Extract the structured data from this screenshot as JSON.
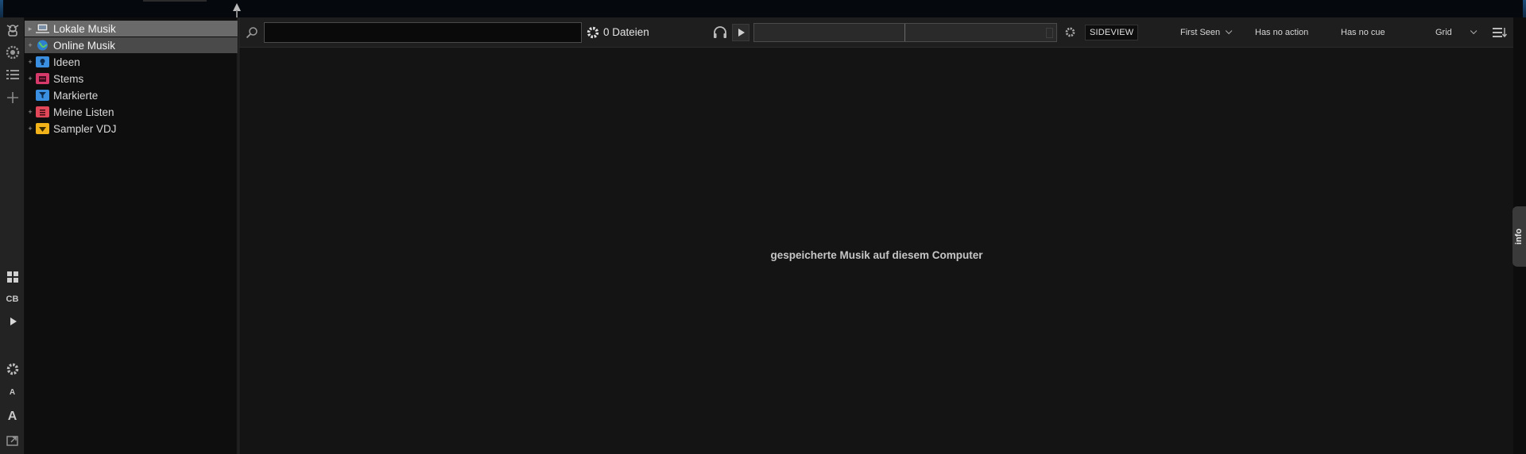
{
  "tree": {
    "items": [
      {
        "label": "Lokale Musik",
        "icon": "computer-icon",
        "color": "#9aa7b5"
      },
      {
        "label": "Online Musik",
        "icon": "globe-icon",
        "color": "#3a8fd8"
      },
      {
        "label": "Ideen",
        "icon": "folder-idea-icon",
        "color": "#3b8fe0"
      },
      {
        "label": "Stems",
        "icon": "folder-stems-icon",
        "color": "#d63a6a"
      },
      {
        "label": "Markierte",
        "icon": "folder-filter-icon",
        "color": "#3b8fe0"
      },
      {
        "label": "Meine Listen",
        "icon": "folder-list-icon",
        "color": "#e0485a"
      },
      {
        "label": "Sampler VDJ",
        "icon": "folder-sampler-icon",
        "color": "#f2b21a"
      }
    ]
  },
  "rail": {
    "cb_label": "CB",
    "small_a_label": "A",
    "big_a_label": "A"
  },
  "toolbar": {
    "search_value": "",
    "search_placeholder": "",
    "file_count": "0 Dateien",
    "sideview_label": "SIDEVIEW",
    "sort_label": "First Seen",
    "filter_action_label": "Has no action",
    "filter_cue_label": "Has no cue",
    "view_mode_label": "Grid"
  },
  "main": {
    "empty_message": "gespeicherte Musik auf diesem Computer"
  },
  "info_tab": {
    "label": "info"
  }
}
